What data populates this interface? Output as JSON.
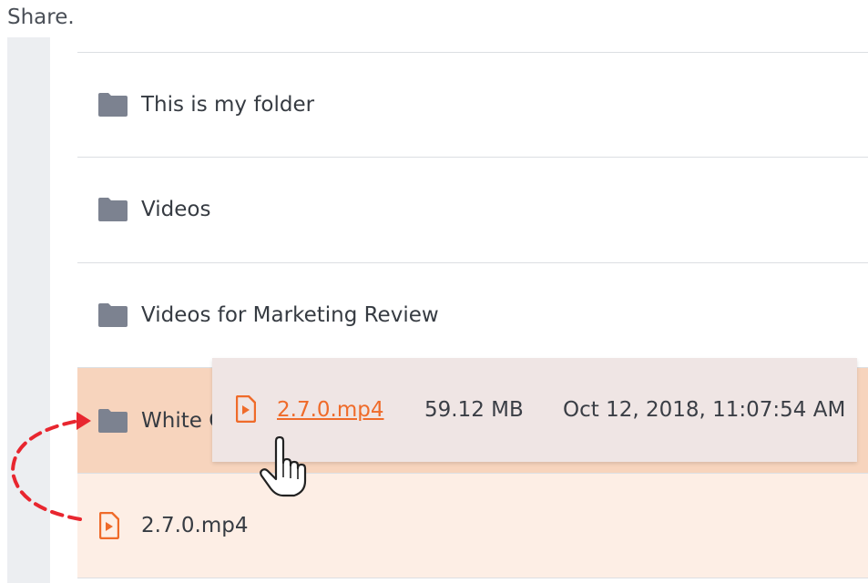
{
  "header": {
    "text": "Share."
  },
  "rows": [
    {
      "label": "This is my folder",
      "icon": "folder-icon"
    },
    {
      "label": "Videos",
      "icon": "folder-icon"
    },
    {
      "label": "Videos for Marketing Review",
      "icon": "folder-icon"
    },
    {
      "label": "White C",
      "icon": "folder-icon"
    },
    {
      "label": "2.7.0.mp4",
      "icon": "video-file-icon"
    }
  ],
  "drag_card": {
    "file_name": "2.7.0.mp4",
    "size": "59.12 MB",
    "date": "Oct 12, 2018, 11:07:54 AM"
  },
  "colors": {
    "accent": "#ef6b2a",
    "folder": "#7c8290",
    "drop_target_bg": "#f7d4bd",
    "source_bg": "#fdeee5",
    "arrow": "#e8262f"
  }
}
